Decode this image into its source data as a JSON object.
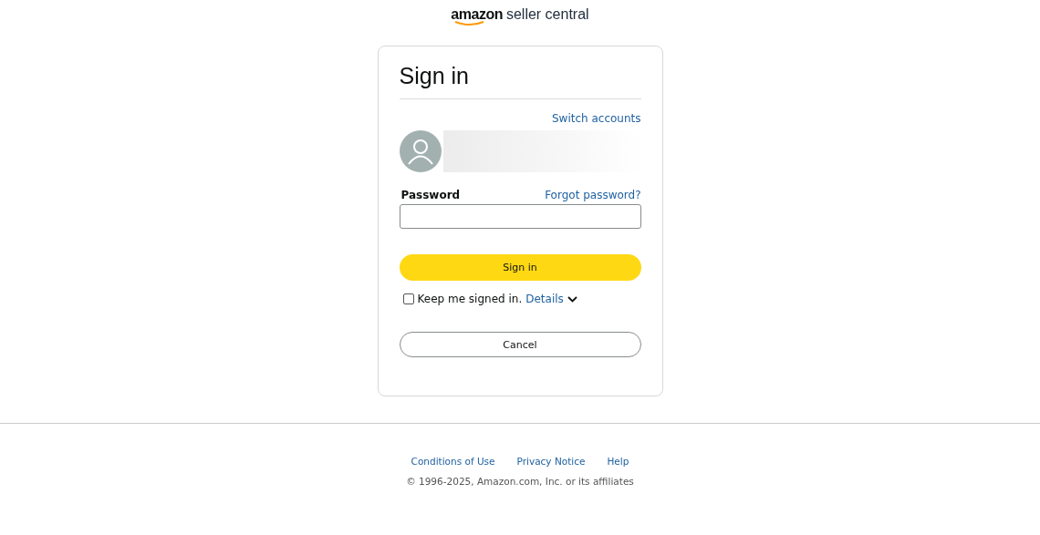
{
  "logo": {
    "brand": "amazon",
    "product": "seller central"
  },
  "card": {
    "title": "Sign in",
    "switch_accounts": "Switch accounts",
    "password": {
      "label": "Password",
      "forgot": "Forgot password?"
    },
    "sign_in_button": "Sign in",
    "keep_signed_in": {
      "label": "Keep me signed in.",
      "details": "Details",
      "checked": false
    },
    "cancel_button": "Cancel"
  },
  "footer": {
    "links": [
      "Conditions of Use",
      "Privacy Notice",
      "Help"
    ],
    "copyright": "© 1996-2025, Amazon.com, Inc. or its affiliates"
  }
}
